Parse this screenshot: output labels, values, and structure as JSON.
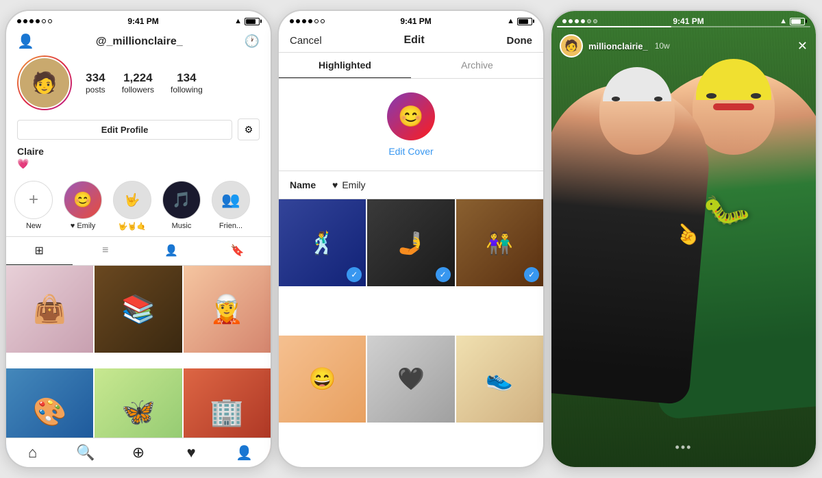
{
  "phone1": {
    "statusBar": {
      "dots": [
        "filled",
        "filled",
        "filled",
        "filled",
        "empty",
        "empty"
      ],
      "time": "9:41 PM",
      "battery": true
    },
    "header": {
      "userIcon": "👤",
      "username": "@_millionclaire_",
      "historyIcon": "🕐"
    },
    "stats": {
      "posts": {
        "count": "334",
        "label": "posts"
      },
      "followers": {
        "count": "1,224",
        "label": "followers"
      },
      "following": {
        "count": "134",
        "label": "following"
      }
    },
    "profileName": "Claire",
    "profileBio": "💗",
    "editProfileLabel": "Edit Profile",
    "settingsIcon": "⚙",
    "highlights": [
      {
        "label": "New",
        "type": "new",
        "icon": "+"
      },
      {
        "label": "♥ Emily",
        "type": "story1",
        "icon": "😊"
      },
      {
        "label": "🤟🤘🤙",
        "type": "story2",
        "icon": "🤟"
      },
      {
        "label": "Music",
        "type": "story3",
        "icon": "🎵"
      },
      {
        "label": "Frien...",
        "type": "story4",
        "icon": "👥"
      }
    ],
    "tabs": [
      {
        "icon": "⊞",
        "active": true
      },
      {
        "icon": "☰",
        "active": false
      },
      {
        "icon": "👤",
        "active": false
      },
      {
        "icon": "🔖",
        "active": false
      }
    ],
    "photos": [
      {
        "type": "handbag",
        "emoji": "👜"
      },
      {
        "type": "books",
        "emoji": "📚"
      },
      {
        "type": "girl",
        "emoji": "🧝"
      },
      {
        "type": "stripes",
        "emoji": "🎨"
      },
      {
        "type": "butterflies",
        "emoji": "🦋"
      },
      {
        "type": "building",
        "emoji": "🏢"
      }
    ],
    "bottomNav": [
      {
        "icon": "⌂",
        "name": "home"
      },
      {
        "icon": "🔍",
        "name": "search"
      },
      {
        "icon": "⊕",
        "name": "add"
      },
      {
        "icon": "♥",
        "name": "activity"
      },
      {
        "icon": "👤",
        "name": "profile"
      }
    ]
  },
  "phone2": {
    "statusBar": {
      "time": "9:41 PM"
    },
    "header": {
      "cancelLabel": "Cancel",
      "title": "Edit",
      "doneLabel": "Done"
    },
    "tabs": [
      {
        "label": "Highlighted",
        "active": true
      },
      {
        "label": "Archive",
        "active": false
      }
    ],
    "cover": {
      "editCoverLabel": "Edit Cover",
      "emoji": "😊"
    },
    "name": {
      "label": "Name",
      "heartIcon": "♥",
      "value": "Emily"
    },
    "photos": [
      {
        "type": "ep1",
        "checked": true,
        "emoji": "🕺"
      },
      {
        "type": "ep2",
        "checked": true,
        "emoji": "🤳"
      },
      {
        "type": "ep3",
        "checked": true,
        "emoji": "👫"
      },
      {
        "type": "ep4",
        "checked": false,
        "emoji": "😄"
      },
      {
        "type": "ep5",
        "checked": false,
        "emoji": "🖤"
      },
      {
        "type": "ep6",
        "checked": false,
        "emoji": "👟"
      }
    ]
  },
  "phone3": {
    "statusBar": {
      "time": "9:41 PM"
    },
    "story": {
      "username": "millionclairie_",
      "timeAgo": "10w",
      "closeIcon": "✕",
      "dotsIcon": "•••"
    }
  }
}
